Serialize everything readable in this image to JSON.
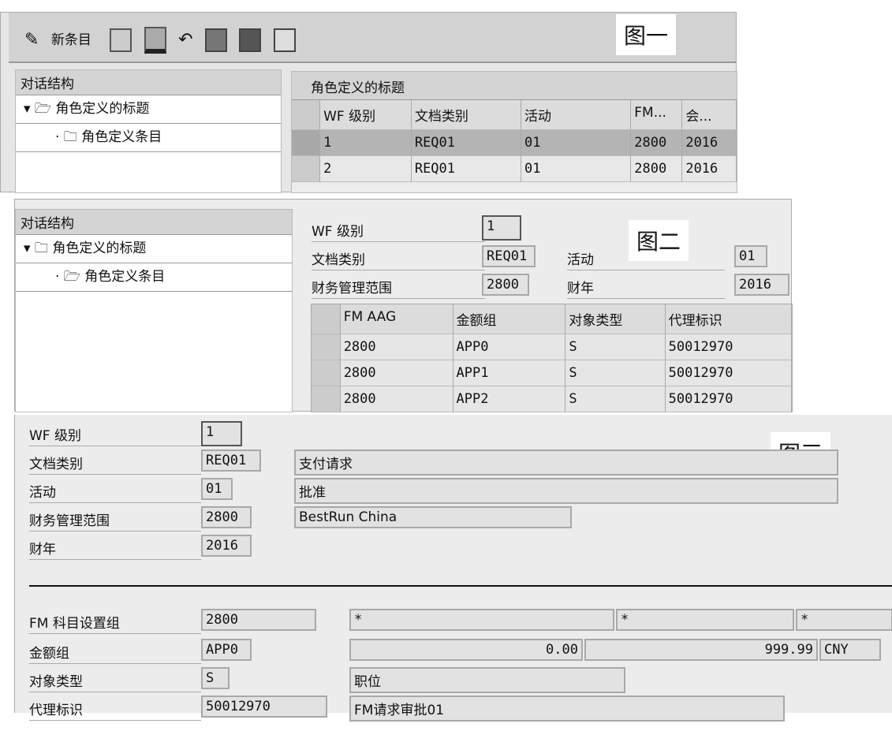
{
  "fig1": {
    "tag": "图一",
    "toolbar": {
      "new_entry": "新条目",
      "icons": [
        "change-display-icon",
        "copy-icon",
        "delete-icon",
        "undo-icon",
        "select-all-icon",
        "select-block-icon",
        "deselect-icon"
      ]
    },
    "tree": {
      "header": "对话结构",
      "items": [
        "角色定义的标题",
        "角色定义条目"
      ]
    },
    "table": {
      "title": "角色定义的标题",
      "columns": [
        "WF 级别",
        "文档类别",
        "活动",
        "FM...",
        "会..."
      ],
      "rows": [
        [
          "1",
          "REQ01",
          "01",
          "2800",
          "2016"
        ],
        [
          "2",
          "REQ01",
          "01",
          "2800",
          "2016"
        ]
      ]
    }
  },
  "fig2": {
    "tag": "图二",
    "tree": {
      "header": "对话结构",
      "items": [
        "角色定义的标题",
        "角色定义条目"
      ]
    },
    "form": {
      "wf_level_label": "WF 级别",
      "wf_level": "1",
      "doc_type_label": "文档类别",
      "doc_type": "REQ01",
      "activity_label": "活动",
      "activity": "01",
      "fm_area_label": "财务管理范围",
      "fm_area": "2800",
      "fiscal_year_label": "财年",
      "fiscal_year": "2016"
    },
    "table": {
      "columns": [
        "FM AAG",
        "金额组",
        "对象类型",
        "代理标识"
      ],
      "rows": [
        [
          "2800",
          "APP0",
          "S",
          "50012970"
        ],
        [
          "2800",
          "APP1",
          "S",
          "50012970"
        ],
        [
          "2800",
          "APP2",
          "S",
          "50012970"
        ]
      ]
    }
  },
  "fig3": {
    "tag": "图三",
    "wf_level_label": "WF 级别",
    "wf_level": "1",
    "doc_type_label": "文档类别",
    "doc_type": "REQ01",
    "doc_type_desc": "支付请求",
    "activity_label": "活动",
    "activity": "01",
    "activity_desc": "批准",
    "fm_area_label": "财务管理范围",
    "fm_area": "2800",
    "fm_area_desc": "BestRun China",
    "fiscal_year_label": "财年",
    "fiscal_year": "2016",
    "aag_label": "FM 科目设置组",
    "aag": "2800",
    "aag_parts": [
      "*",
      "*",
      "*"
    ],
    "amount_group_label": "金额组",
    "amount_group": "APP0",
    "amount_from": "0.00",
    "amount_to": "999.99",
    "currency": "CNY",
    "object_type_label": "对象类型",
    "object_type": "S",
    "object_type_desc": "职位",
    "agent_label": "代理标识",
    "agent": "50012970",
    "agent_desc": "FM请求审批01"
  }
}
